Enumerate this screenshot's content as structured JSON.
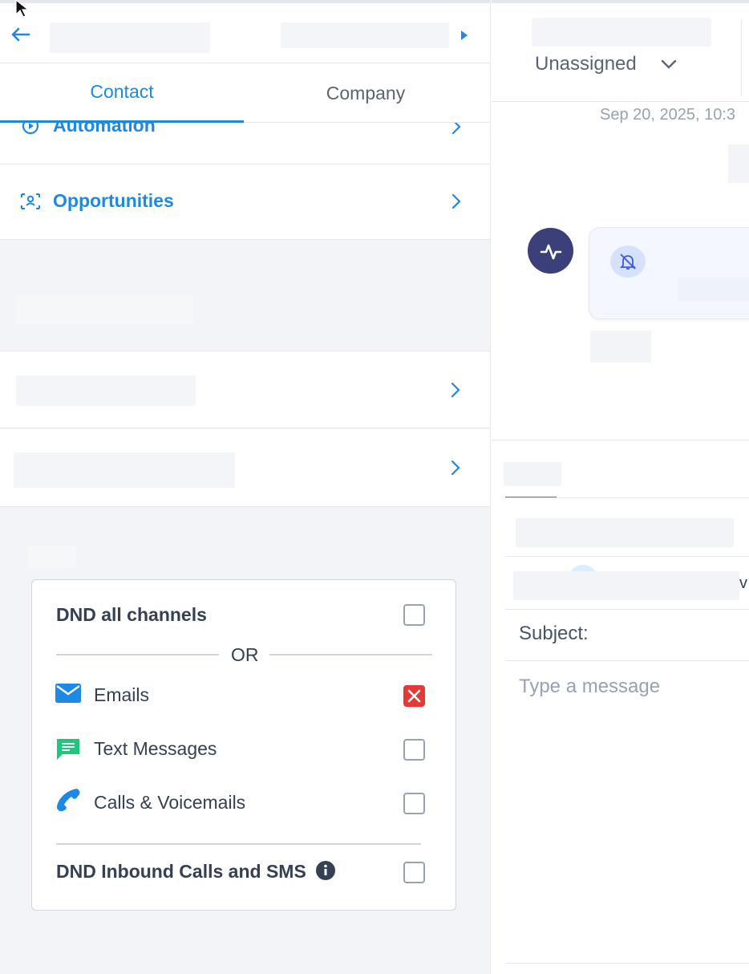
{
  "tabs": {
    "contact": "Contact",
    "company": "Company"
  },
  "rows": {
    "automation": "Automation",
    "opportunities": "Opportunities"
  },
  "dnd": {
    "all_channels": "DND all channels",
    "or": "OR",
    "emails": "Emails",
    "text_messages": "Text Messages",
    "calls": "Calls & Voicemails",
    "inbound": "DND Inbound Calls and SMS",
    "emails_state": "x-marked"
  },
  "conversation": {
    "assignee": "Unassigned",
    "timestamp": "Sep 20, 2025, 10:3",
    "subject_label": "Subject:",
    "message_placeholder": "Type a message"
  },
  "colors": {
    "accent": "#1e88e5",
    "danger": "#e53935",
    "sms_green": "#1ec77b",
    "avatar": "#3b3f7a"
  }
}
